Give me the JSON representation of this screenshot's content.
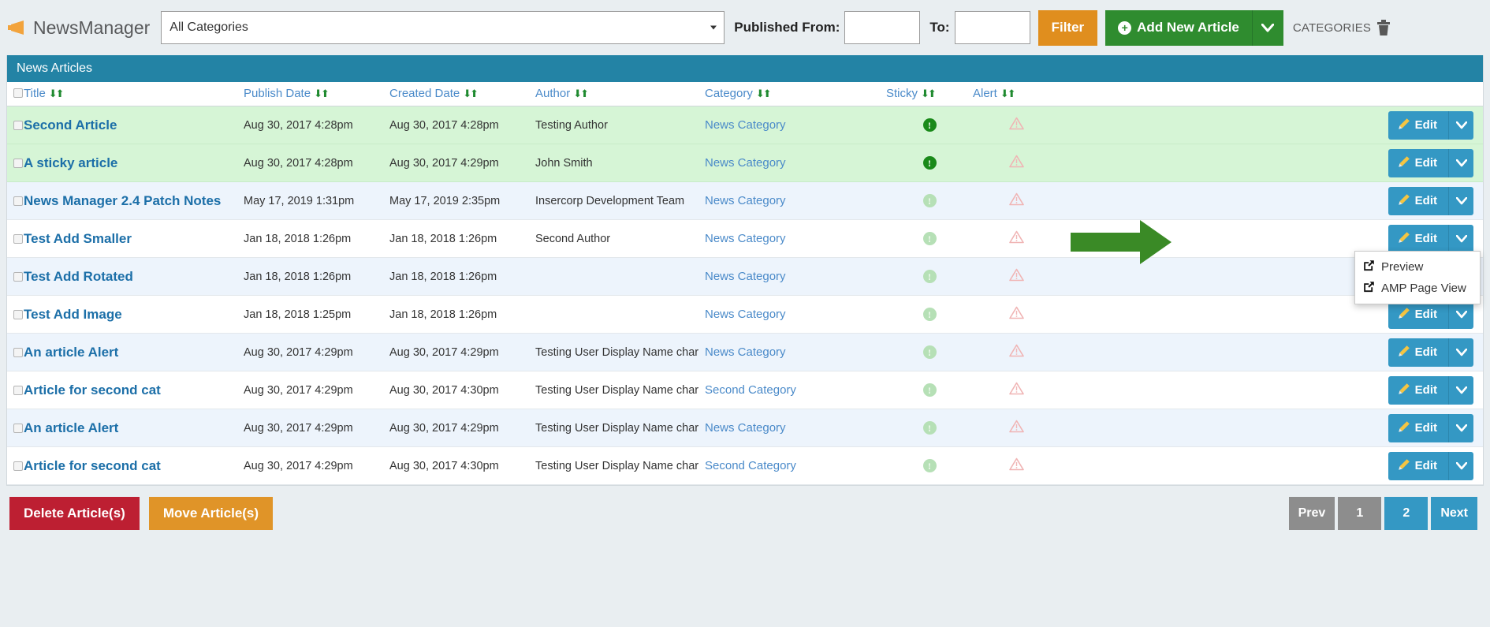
{
  "header": {
    "brand": "NewsManager",
    "brand_icon": "megaphone-icon",
    "category_select_value": "All Categories",
    "published_from_label": "Published From:",
    "published_from_value": "",
    "to_label": "To:",
    "to_value": "",
    "filter_label": "Filter",
    "add_new_label": "Add New Article",
    "categories_label": "CATEGORIES",
    "trash_icon": "trash-icon",
    "colors": {
      "filter": "#e08e1e",
      "add": "#2f8c2f"
    }
  },
  "panel": {
    "title": "News Articles",
    "header_color": "#2383a5",
    "columns": [
      {
        "label": "Title",
        "sortable": true
      },
      {
        "label": "Publish Date",
        "sortable": true
      },
      {
        "label": "Created Date",
        "sortable": true
      },
      {
        "label": "Author",
        "sortable": true
      },
      {
        "label": "Category",
        "sortable": true
      },
      {
        "label": "Sticky",
        "sortable": true
      },
      {
        "label": "Alert",
        "sortable": true
      }
    ],
    "edit_label": "Edit",
    "rows": [
      {
        "title": "Second Article",
        "publish": "Aug 30, 2017 4:28pm",
        "created": "Aug 30, 2017 4:28pm",
        "author": "Testing Author",
        "category": "News Category",
        "sticky": true,
        "alert": true,
        "highlight": "sticky"
      },
      {
        "title": "A sticky article",
        "publish": "Aug 30, 2017 4:28pm",
        "created": "Aug 30, 2017 4:29pm",
        "author": "John Smith",
        "category": "News Category",
        "sticky": true,
        "alert": true,
        "highlight": "sticky"
      },
      {
        "title": "News Manager 2.4 Patch Notes",
        "publish": "May 17, 2019 1:31pm",
        "created": "May 17, 2019 2:35pm",
        "author": "Insercorp Development Team",
        "category": "News Category",
        "sticky": false,
        "alert": true,
        "highlight": "odd"
      },
      {
        "title": "Test Add Smaller",
        "publish": "Jan 18, 2018 1:26pm",
        "created": "Jan 18, 2018 1:26pm",
        "author": "Second Author",
        "category": "News Category",
        "sticky": false,
        "alert": true,
        "highlight": "even"
      },
      {
        "title": "Test Add Rotated",
        "publish": "Jan 18, 2018 1:26pm",
        "created": "Jan 18, 2018 1:26pm",
        "author": "",
        "category": "News Category",
        "sticky": false,
        "alert": true,
        "highlight": "odd"
      },
      {
        "title": "Test Add Image",
        "publish": "Jan 18, 2018 1:25pm",
        "created": "Jan 18, 2018 1:26pm",
        "author": "",
        "category": "News Category",
        "sticky": false,
        "alert": true,
        "highlight": "even"
      },
      {
        "title": "An article Alert",
        "publish": "Aug 30, 2017 4:29pm",
        "created": "Aug 30, 2017 4:29pm",
        "author": "Testing User Display Name char",
        "category": "News Category",
        "sticky": false,
        "alert": true,
        "highlight": "odd"
      },
      {
        "title": "Article for second cat",
        "publish": "Aug 30, 2017 4:29pm",
        "created": "Aug 30, 2017 4:30pm",
        "author": "Testing User Display Name char",
        "category": "Second Category",
        "sticky": false,
        "alert": true,
        "highlight": "even"
      },
      {
        "title": "An article Alert",
        "publish": "Aug 30, 2017 4:29pm",
        "created": "Aug 30, 2017 4:29pm",
        "author": "Testing User Display Name char",
        "category": "News Category",
        "sticky": false,
        "alert": true,
        "highlight": "odd"
      },
      {
        "title": "Article for second cat",
        "publish": "Aug 30, 2017 4:29pm",
        "created": "Aug 30, 2017 4:30pm",
        "author": "Testing User Display Name char",
        "category": "Second Category",
        "sticky": false,
        "alert": true,
        "highlight": "even"
      }
    ]
  },
  "dropdown": {
    "preview_label": "Preview",
    "amp_label": "AMP Page View",
    "icon": "external-link-icon"
  },
  "annotation": {
    "shape": "green-arrow",
    "color": "#3a8a26"
  },
  "footer": {
    "delete_label": "Delete Article(s)",
    "move_label": "Move Article(s)",
    "pagination": [
      {
        "label": "Prev",
        "state": "disabled"
      },
      {
        "label": "1",
        "state": "disabled"
      },
      {
        "label": "2",
        "state": "active"
      },
      {
        "label": "Next",
        "state": "next"
      }
    ]
  }
}
